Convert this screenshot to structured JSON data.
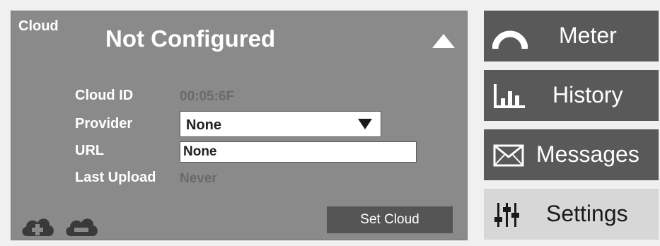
{
  "cloud_panel": {
    "tag": "Cloud",
    "status_title": "Not Configured",
    "fields": {
      "cloud_id_label": "Cloud ID",
      "cloud_id_value": "00:05:6F",
      "provider_label": "Provider",
      "provider_value": "None",
      "url_label": "URL",
      "url_value": "None",
      "last_upload_label": "Last Upload",
      "last_upload_value": "Never"
    },
    "icons": [
      "cloud-add-icon",
      "cloud-remove-icon",
      "triangle-up-icon",
      "triangle-down-icon"
    ],
    "set_cloud_label": "Set Cloud"
  },
  "nav": {
    "items": [
      {
        "label": "Meter",
        "icon": "gauge-icon",
        "active": false
      },
      {
        "label": "History",
        "icon": "bar-chart-icon",
        "active": false
      },
      {
        "label": "Messages",
        "icon": "envelope-icon",
        "active": false
      },
      {
        "label": "Settings",
        "icon": "sliders-icon",
        "active": true
      }
    ]
  },
  "colors": {
    "panel_bg": "#8a8a8a",
    "nav_bg": "#595959",
    "nav_active_bg": "#d7d7d7",
    "muted_text": "#6a6a6a"
  }
}
